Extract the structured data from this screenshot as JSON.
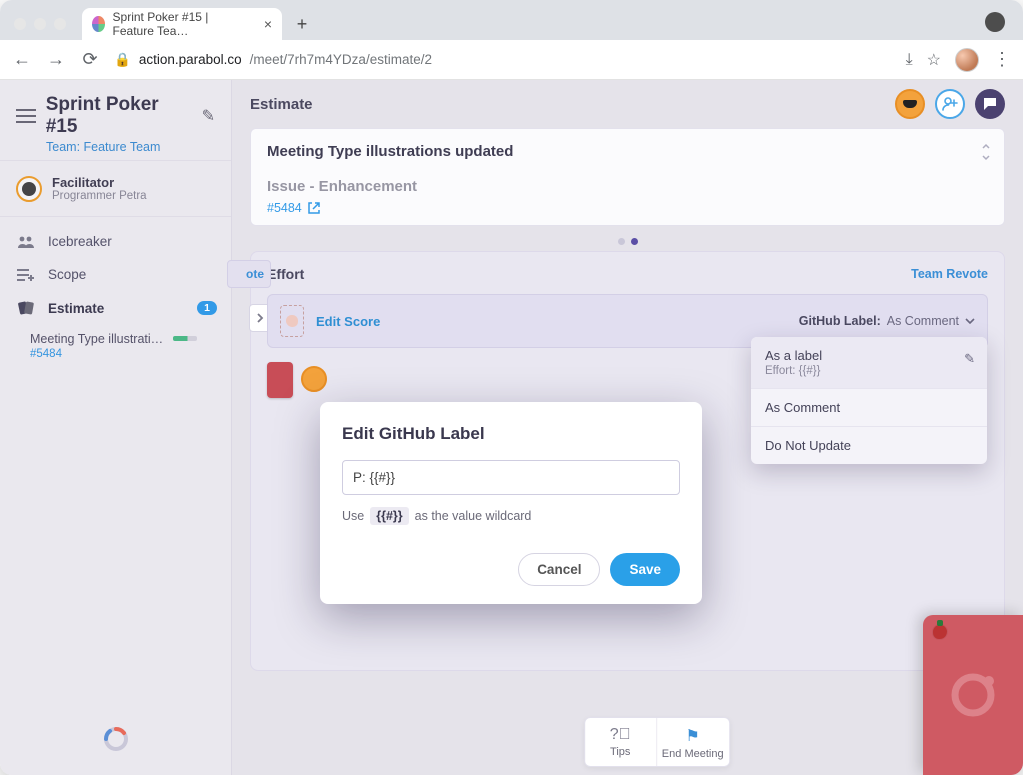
{
  "browser": {
    "tab_title": "Sprint Poker #15 | Feature Tea…",
    "url_host": "action.parabol.co",
    "url_path": "/meet/7rh7m4YDza/estimate/2"
  },
  "sidebar": {
    "title": "Sprint Poker #15",
    "team_label": "Team: Feature Team",
    "facilitator": {
      "label": "Facilitator",
      "name": "Programmer Petra"
    },
    "items": [
      {
        "label": "Icebreaker"
      },
      {
        "label": "Scope"
      },
      {
        "label": "Estimate",
        "badge": "1"
      }
    ],
    "sub": {
      "title": "Meeting Type illustrati…",
      "issue": "#5484"
    }
  },
  "top": {
    "title": "Estimate"
  },
  "story": {
    "title": "Meeting Type illustrations updated",
    "subtitle": "Issue - Enhancement",
    "issue": "#5484"
  },
  "panel": {
    "title": "Effort",
    "revote": "Team Revote",
    "vote_pill": "ote",
    "edit_score": "Edit Score",
    "gh_label": "GitHub Label:",
    "gh_value": "As Comment"
  },
  "menu": {
    "opt1": {
      "title": "As a label",
      "sub": "Effort: {{#}}"
    },
    "opt2": "As Comment",
    "opt3": "Do Not Update"
  },
  "modal": {
    "title": "Edit GitHub Label",
    "input_value": "P: {{#}}",
    "hint_pre": "Use",
    "hint_code": "{{#}}",
    "hint_post": "as the value wildcard",
    "cancel": "Cancel",
    "save": "Save"
  },
  "footer": {
    "tips": "Tips",
    "end": "End Meeting"
  }
}
